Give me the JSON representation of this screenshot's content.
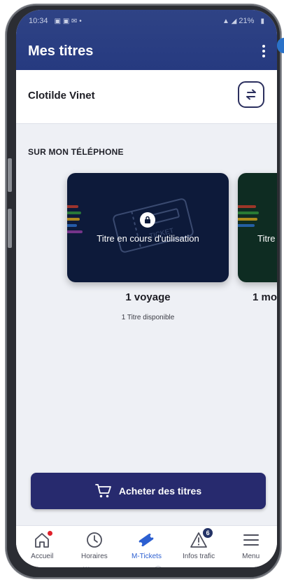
{
  "status_bar": {
    "time": "10:34",
    "battery": "21%"
  },
  "header": {
    "title": "Mes titres"
  },
  "user": {
    "name": "Clotilde Vinet"
  },
  "section": {
    "title": "SUR MON TÉLÉPHONE"
  },
  "cards": [
    {
      "status": "Titre en cours d'utilisation",
      "title": "1 voyage",
      "subtitle": "1 Titre disponible",
      "ticket_word": "TICKET"
    },
    {
      "status": "Titre",
      "title": "1 mo"
    }
  ],
  "buy_button": {
    "label": "Acheter des titres"
  },
  "bottom_nav": [
    {
      "label": "Accueil",
      "icon": "home-icon"
    },
    {
      "label": "Horaires",
      "icon": "clock-icon"
    },
    {
      "label": "M-Tickets",
      "icon": "ticket-icon",
      "active": true
    },
    {
      "label": "Infos trafic",
      "icon": "warning-icon",
      "badge": "6"
    },
    {
      "label": "Menu",
      "icon": "menu-icon"
    }
  ],
  "colors": {
    "appbar": "#2f4385",
    "button": "#272a6e",
    "active_nav": "#2c5fd1",
    "card_main": "#0d1a3a",
    "card_second": "#0e2c22"
  }
}
